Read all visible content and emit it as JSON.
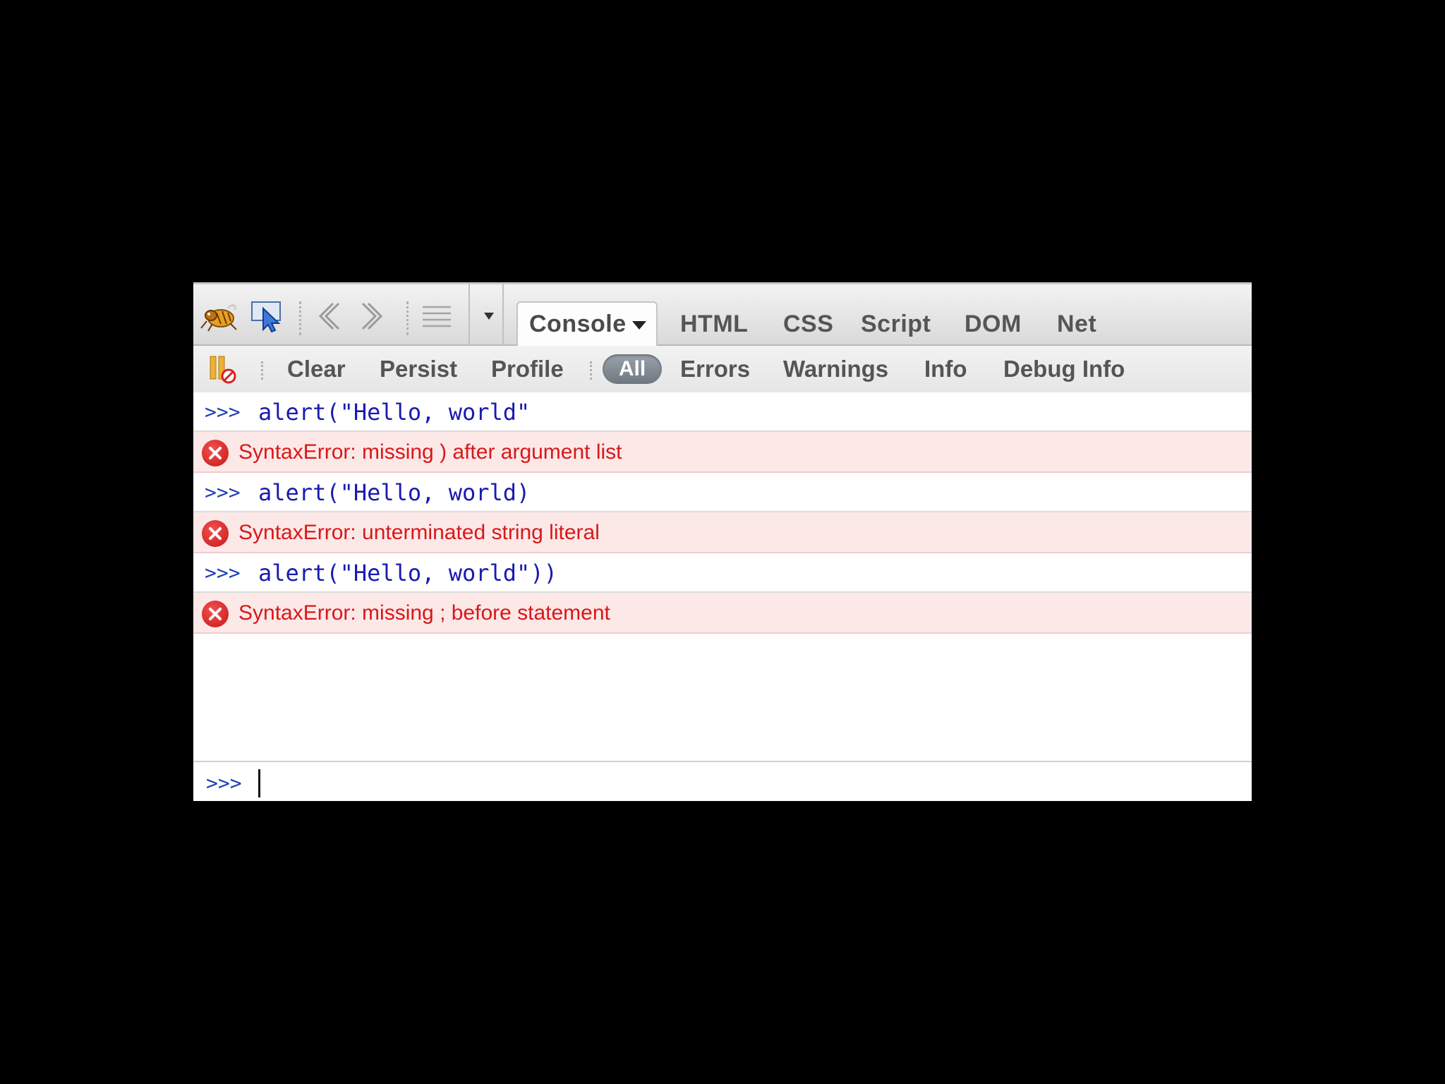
{
  "toolbar": {
    "icons": [
      "firebug-icon",
      "inspect-pointer-icon",
      "back-arrow-icon",
      "forward-arrow-icon",
      "list-icon",
      "dropdown-triangle-icon"
    ],
    "tabs": [
      {
        "label": "Console",
        "active": true
      },
      {
        "label": "HTML"
      },
      {
        "label": "CSS"
      },
      {
        "label": "Script"
      },
      {
        "label": "DOM"
      },
      {
        "label": "Net"
      }
    ]
  },
  "filterbar": {
    "icon": "break-on-errors-icon",
    "actions": [
      "Clear",
      "Persist",
      "Profile"
    ],
    "filters": [
      "All",
      "Errors",
      "Warnings",
      "Info",
      "Debug Info"
    ],
    "active_filter": "All"
  },
  "log": [
    {
      "type": "command",
      "prompt": ">>>",
      "text": "alert(\"Hello, world\""
    },
    {
      "type": "error",
      "text": "SyntaxError: missing ) after argument list"
    },
    {
      "type": "command",
      "prompt": ">>>",
      "text": "alert(\"Hello, world)"
    },
    {
      "type": "error",
      "text": "SyntaxError: unterminated string literal"
    },
    {
      "type": "command",
      "prompt": ">>>",
      "text": "alert(\"Hello, world\"))"
    },
    {
      "type": "error",
      "text": "SyntaxError: missing ; before statement"
    }
  ],
  "commandline": {
    "prompt": ">>>",
    "value": ""
  },
  "colors": {
    "background": "#000000",
    "error_row": "#fde8e8",
    "error_text": "#d81818",
    "command_text": "#1a1ab0",
    "pill": "#7a838b"
  }
}
